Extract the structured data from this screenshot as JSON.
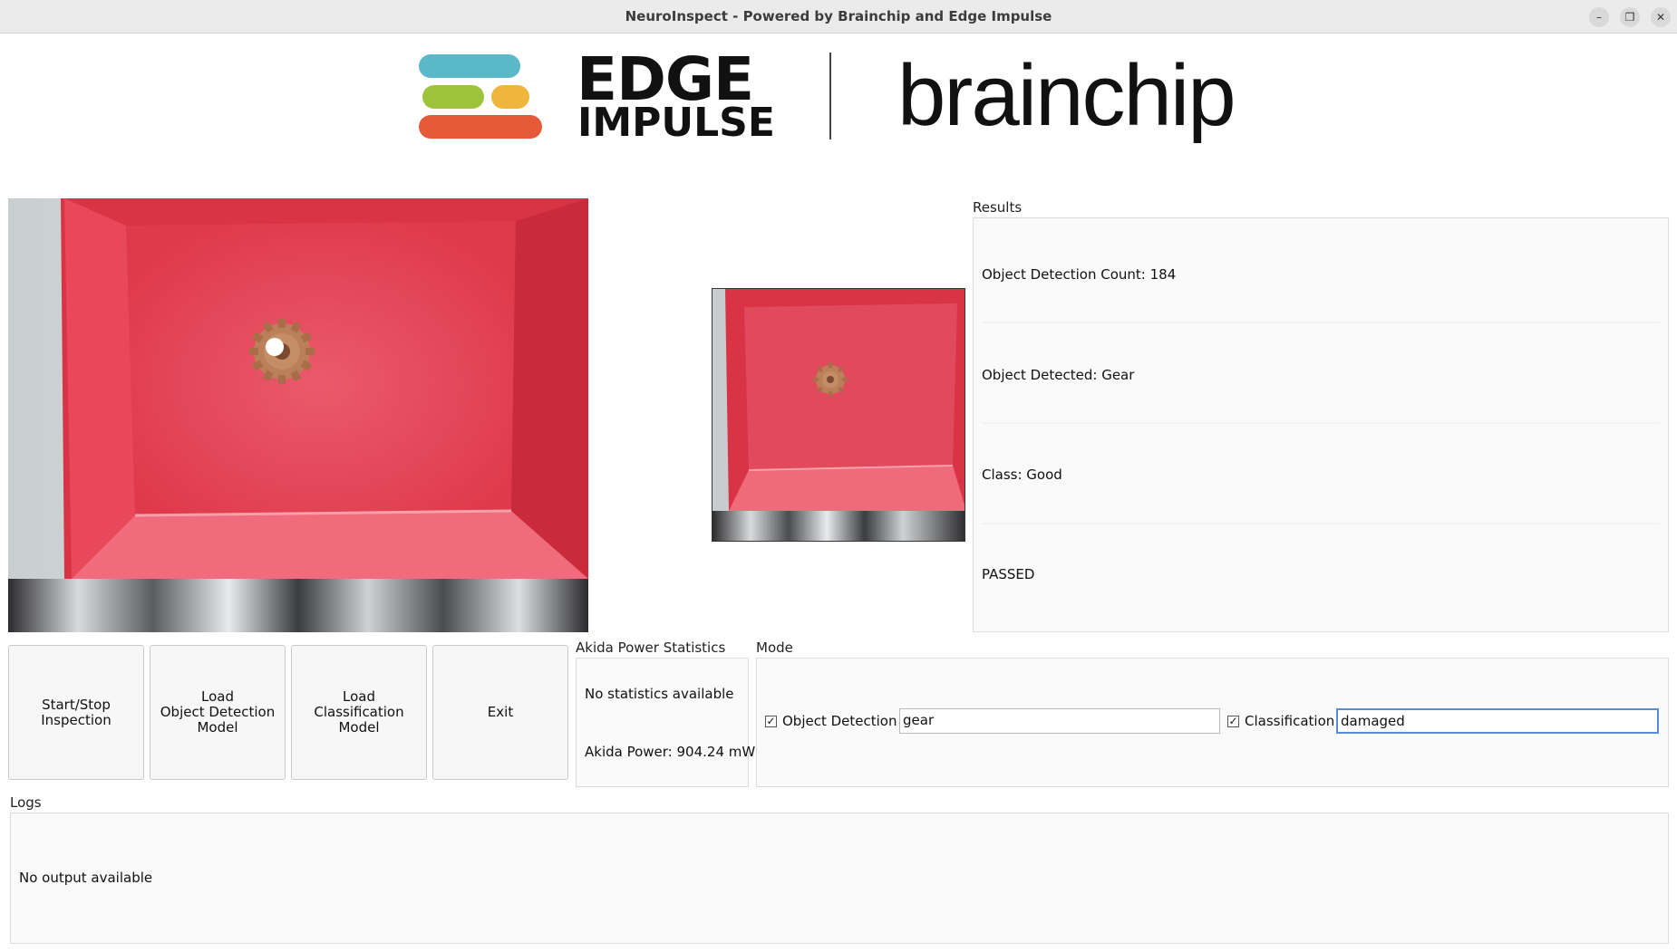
{
  "window": {
    "title": "NeuroInspect - Powered by Brainchip and Edge Impulse",
    "controls": [
      "minimize-icon",
      "restore-icon",
      "close-icon"
    ]
  },
  "logos": {
    "edge_impulse_line1": "EDGE",
    "edge_impulse_line2": "IMPULSE",
    "brainchip": "brainchip",
    "edge_impulse_colors": [
      "#5bb8c9",
      "#9cc33b",
      "#f0b53c",
      "#e65a3a"
    ]
  },
  "results": {
    "label": "Results",
    "count": "Object Detection Count: 184",
    "detected": "Object Detected: Gear",
    "class": "Class: Good",
    "verdict": "PASSED"
  },
  "buttons": {
    "start_stop": "Start/Stop\nInspection",
    "load_od": "Load\nObject Detection\nModel",
    "load_cls": "Load\nClassification\nModel",
    "exit": "Exit"
  },
  "power": {
    "label": "Akida Power Statistics",
    "stats": "No statistics available",
    "power": "Akida Power: 904.24 mW"
  },
  "mode": {
    "label": "Mode",
    "od_label": "Object Detection",
    "od_checked": true,
    "od_value": "gear",
    "cls_label": "Classification",
    "cls_checked": true,
    "cls_value": "damaged"
  },
  "logs": {
    "label": "Logs",
    "output": "No output available"
  },
  "colors": {
    "tray_red": "#e03a4c",
    "gear": "#b9805a"
  }
}
